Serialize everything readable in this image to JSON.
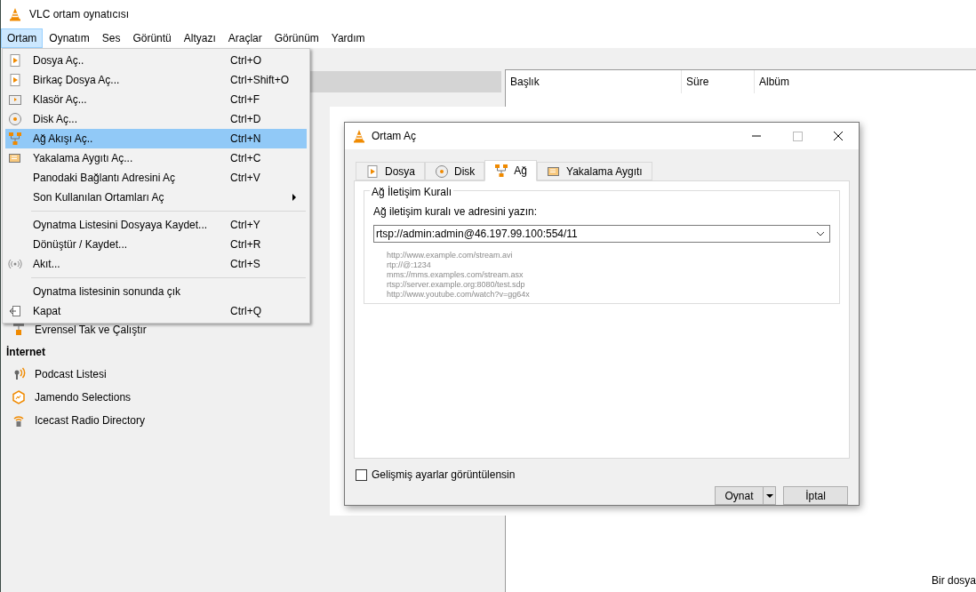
{
  "window": {
    "title": "VLC ortam oynatıcısı"
  },
  "menubar": [
    {
      "label": "Ortam",
      "selected": true
    },
    {
      "label": "Oynatım",
      "selected": false
    },
    {
      "label": "Ses",
      "selected": false
    },
    {
      "label": "Görüntü",
      "selected": false
    },
    {
      "label": "Altyazı",
      "selected": false
    },
    {
      "label": "Araçlar",
      "selected": false
    },
    {
      "label": "Görünüm",
      "selected": false
    },
    {
      "label": "Yardım",
      "selected": false
    }
  ],
  "menu": [
    {
      "kind": "item",
      "label": "Dosya Aç..",
      "shortcut": "Ctrl+O",
      "selected": false
    },
    {
      "kind": "item",
      "label": "Birkaç Dosya Aç...",
      "shortcut": "Ctrl+Shift+O",
      "selected": false
    },
    {
      "kind": "item",
      "label": "Klasör Aç...",
      "shortcut": "Ctrl+F",
      "selected": false
    },
    {
      "kind": "item",
      "label": "Disk Aç...",
      "shortcut": "Ctrl+D",
      "selected": false
    },
    {
      "kind": "item",
      "label": "Ağ Akışı Aç..",
      "shortcut": "Ctrl+N",
      "selected": true
    },
    {
      "kind": "item",
      "label": "Yakalama Aygıtı Aç...",
      "shortcut": "Ctrl+C",
      "selected": false
    },
    {
      "kind": "item",
      "label": "Panodaki Bağlantı Adresini Aç",
      "shortcut": "Ctrl+V",
      "selected": false
    },
    {
      "kind": "submenu",
      "label": "Son Kullanılan Ortamları Aç",
      "selected": false
    },
    {
      "kind": "separator"
    },
    {
      "kind": "item",
      "label": "Oynatma Listesini Dosyaya Kaydet...",
      "shortcut": "Ctrl+Y",
      "selected": false
    },
    {
      "kind": "item",
      "label": "Dönüştür / Kaydet...",
      "shortcut": "Ctrl+R",
      "selected": false
    },
    {
      "kind": "item",
      "label": "Akıt...",
      "shortcut": "Ctrl+S",
      "selected": false
    },
    {
      "kind": "separator"
    },
    {
      "kind": "item",
      "label": "Oynatma listesinin sonunda çık",
      "selected": false
    },
    {
      "kind": "item",
      "label": "Kapat",
      "shortcut": "Ctrl+Q",
      "selected": false
    }
  ],
  "sidebar": [
    {
      "kind": "item",
      "label": "Evrensel Tak ve Çalıştır"
    },
    {
      "kind": "header",
      "label": "İnternet"
    },
    {
      "kind": "item",
      "label": "Podcast Listesi"
    },
    {
      "kind": "item",
      "label": "Jamendo Selections"
    },
    {
      "kind": "item",
      "label": "Icecast Radio Directory"
    }
  ],
  "playlist": {
    "columns": [
      "Başlık",
      "Süre",
      "Albüm"
    ]
  },
  "status_bar": {
    "text": "Bir dosya"
  },
  "dialog": {
    "title": "Ortam Aç",
    "tabs": [
      {
        "label": "Dosya",
        "selected": false
      },
      {
        "label": "Disk",
        "selected": false
      },
      {
        "label": "Ağ",
        "selected": true
      },
      {
        "label": "Yakalama Aygıtı",
        "selected": false
      }
    ],
    "group_title": "Ağ İletişim Kuralı",
    "field_label": "Ağ iletişim kuralı ve adresini yazın:",
    "url_value": "rtsp://admin:admin@46.197.99.100:554/11",
    "examples": [
      "http://www.example.com/stream.avi",
      "rtp://@:1234",
      "mms://mms.examples.com/stream.asx",
      "rtsp://server.example.org:8080/test.sdp",
      "http://www.youtube.com/watch?v=gg64x"
    ],
    "advanced": {
      "label": "Gelişmiş ayarlar görüntülensin",
      "checked": false
    },
    "buttons": [
      {
        "kind": "split",
        "label": "Oynat"
      },
      {
        "kind": "plain",
        "label": "İptal"
      }
    ]
  }
}
